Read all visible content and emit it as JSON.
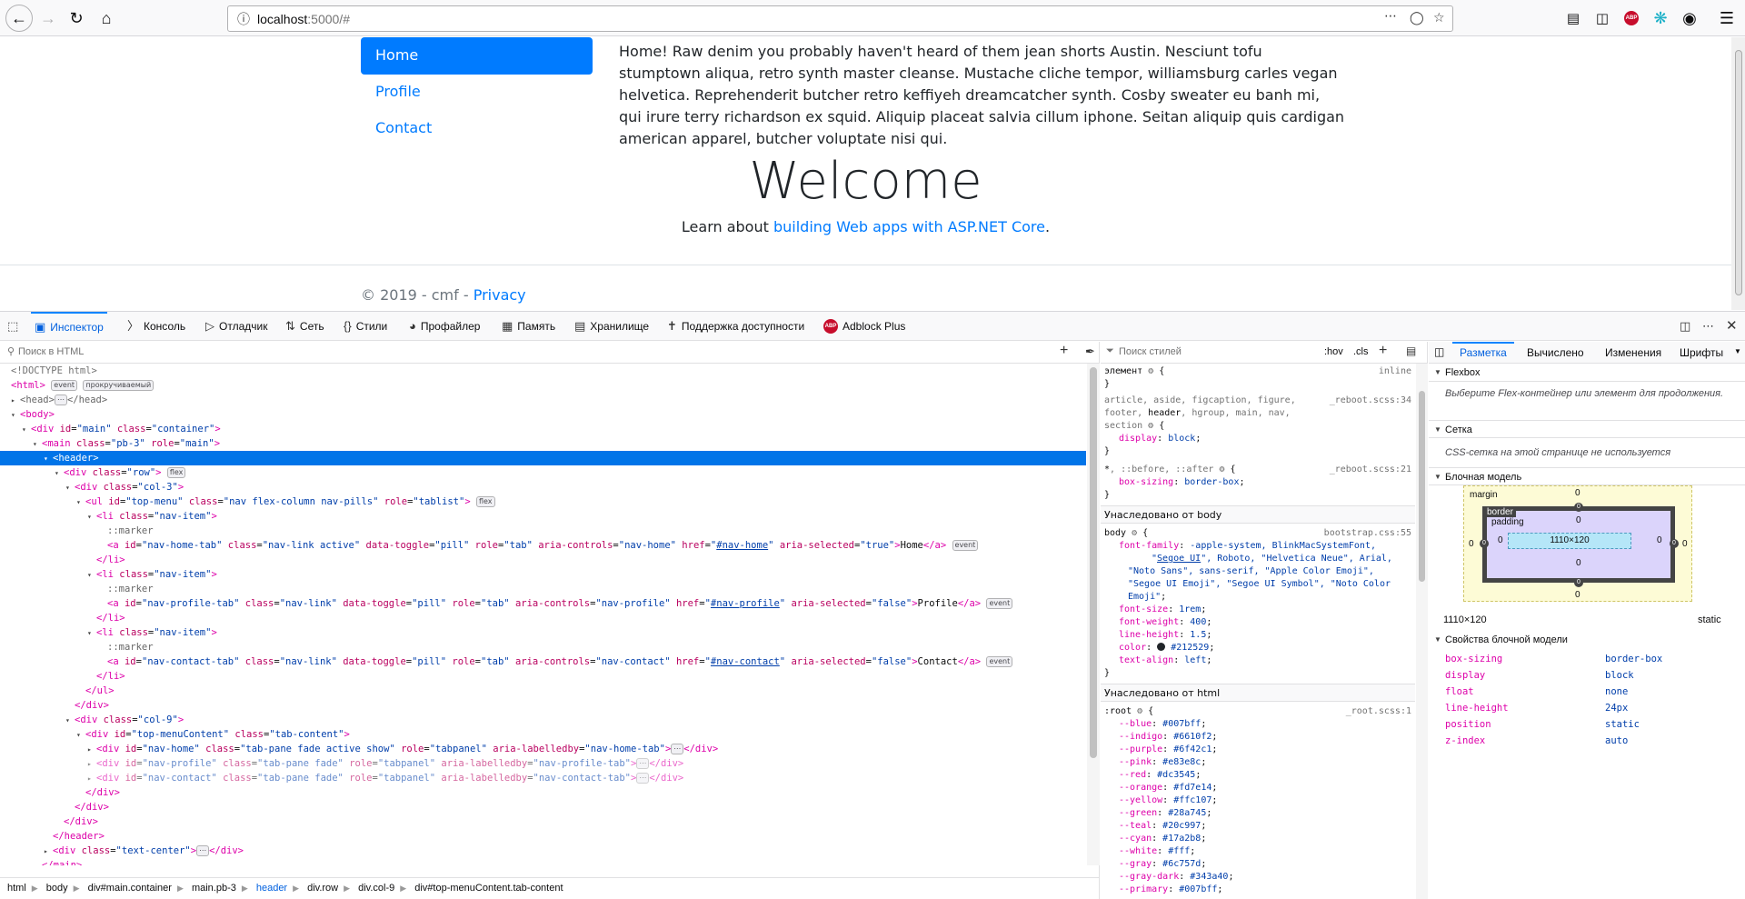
{
  "browser": {
    "url_host": "localhost",
    "url_rest": ":5000/#"
  },
  "page": {
    "nav": [
      "Home",
      "Profile",
      "Contact"
    ],
    "lorem": "Home! Raw denim you probably haven't heard of them jean shorts Austin. Nesciunt tofu stumptown aliqua, retro synth master cleanse. Mustache cliche tempor, williamsburg carles vegan helvetica. Reprehenderit butcher retro keffiyeh dreamcatcher synth. Cosby sweater eu banh mi, qui irure terry richardson ex squid. Aliquip placeat salvia cillum iphone. Seitan aliquip quis cardigan american apparel, butcher voluptate nisi qui.",
    "welcome": "Welcome",
    "learn_prefix": "Learn about ",
    "learn_link": "building Web apps with ASP.NET Core",
    "learn_suffix": ".",
    "footer_prefix": "© 2019 - cmf - ",
    "footer_link": "Privacy"
  },
  "devtools": {
    "tabs": [
      "Инспектор",
      "Консоль",
      "Отладчик",
      "Сеть",
      "Стили",
      "Профайлер",
      "Память",
      "Хранилище",
      "Поддержка доступности",
      "Adblock Plus"
    ],
    "html_search_placeholder": "Поиск в HTML",
    "styles_search_placeholder": "Поиск стилей",
    "hov": ":hov",
    "cls": ".cls",
    "breadcrumbs": [
      "html",
      "body",
      "div#main.container",
      "main.pb-3",
      "header",
      "div.row",
      "div.col-9",
      "div#top-menuContent.tab-content"
    ],
    "layout_tabs": [
      "Разметка",
      "Вычислено",
      "Изменения",
      "Шрифты"
    ],
    "flexbox_title": "Flexbox",
    "flexbox_hint": "Выберите Flex-контейнер или элемент для продолжения.",
    "grid_title": "Сетка",
    "grid_hint": "CSS-сетка на этой странице не используется",
    "boxmodel_title": "Блочная модель",
    "bm_margin": "margin",
    "bm_border": "border",
    "bm_padding": "padding",
    "bm_content": "1110×120",
    "bm_zero": "0",
    "bm_size": "1110×120",
    "bm_position": "static",
    "bm_props_title": "Свойства блочной модели",
    "bm_props": [
      {
        "k": "box-sizing",
        "v": "border-box"
      },
      {
        "k": "display",
        "v": "block"
      },
      {
        "k": "float",
        "v": "none"
      },
      {
        "k": "line-height",
        "v": "24px"
      },
      {
        "k": "position",
        "v": "static"
      },
      {
        "k": "z-index",
        "v": "auto"
      }
    ],
    "inherited_body": "Унаследовано от body",
    "inherited_html": "Унаследовано от html"
  }
}
